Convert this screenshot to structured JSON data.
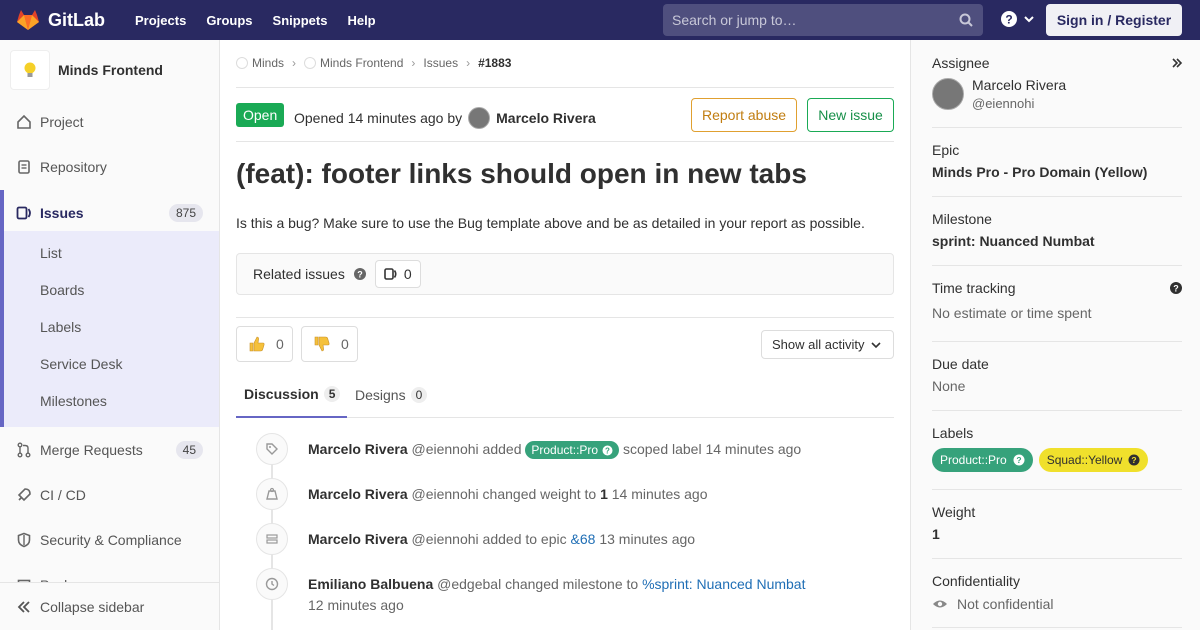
{
  "header": {
    "brand": "GitLab",
    "nav": [
      "Projects",
      "Groups",
      "Snippets",
      "Help"
    ],
    "search_placeholder": "Search or jump to…",
    "sign_in": "Sign in / Register"
  },
  "sidebar": {
    "project_name": "Minds Frontend",
    "items": [
      {
        "label": "Project",
        "icon": "home-icon"
      },
      {
        "label": "Repository",
        "icon": "doc-icon"
      },
      {
        "label": "Issues",
        "icon": "issues-icon",
        "count": "875"
      },
      {
        "label": "Merge Requests",
        "icon": "merge-request-icon",
        "count": "45"
      },
      {
        "label": "CI / CD",
        "icon": "rocket-icon"
      },
      {
        "label": "Security & Compliance",
        "icon": "shield-icon"
      },
      {
        "label": "Packages",
        "icon": "package-icon"
      }
    ],
    "issues_subitems": [
      "List",
      "Boards",
      "Labels",
      "Service Desk",
      "Milestones"
    ],
    "collapse_label": "Collapse sidebar"
  },
  "breadcrumb": [
    "Minds",
    "Minds Frontend",
    "Issues",
    "#1883"
  ],
  "issue": {
    "status": "Open",
    "opened_text": "Opened 14 minutes ago by",
    "author": "Marcelo Rivera",
    "report_abuse": "Report abuse",
    "new_issue": "New issue",
    "title": "(feat): footer links should open in new tabs",
    "description": "Is this a bug? Make sure to use the Bug template above and be as detailed in your report as possible.",
    "related_label": "Related issues",
    "related_count": "0",
    "thumbs_up_count": "0",
    "thumbs_down_count": "0",
    "activity_filter": "Show all activity"
  },
  "tabs": [
    {
      "label": "Discussion",
      "count": "5"
    },
    {
      "label": "Designs",
      "count": "0"
    }
  ],
  "notes": [
    {
      "author": "Marcelo Rivera",
      "handle": "@eiennohi",
      "before": "added",
      "label": "Product::Pro",
      "after": "scoped label 14 minutes ago"
    },
    {
      "author": "Marcelo Rivera",
      "handle": "@eiennohi",
      "before": "changed weight to",
      "strong": "1",
      "after": "14 minutes ago"
    },
    {
      "author": "Marcelo Rivera",
      "handle": "@eiennohi",
      "before": "added to epic",
      "link": "&68",
      "after": "13 minutes ago"
    },
    {
      "author": "Emiliano Balbuena",
      "handle": "@edgebal",
      "before": "changed milestone to",
      "link": "%sprint: Nuanced Numbat",
      "after": "12 minutes ago"
    }
  ],
  "right_sidebar": {
    "assignee_label": "Assignee",
    "assignee_name": "Marcelo Rivera",
    "assignee_handle": "@eiennohi",
    "epic_label": "Epic",
    "epic_value": "Minds Pro - Pro Domain (Yellow)",
    "milestone_label": "Milestone",
    "milestone_value": "sprint: Nuanced Numbat",
    "time_label": "Time tracking",
    "time_value": "No estimate or time spent",
    "due_label": "Due date",
    "due_value": "None",
    "labels_label": "Labels",
    "labels": [
      {
        "text": "Product::Pro",
        "color": "#36a27b"
      },
      {
        "text": "Squad::Yellow",
        "color": "#f0e02c"
      }
    ],
    "weight_label": "Weight",
    "weight_value": "1",
    "conf_label": "Confidentiality",
    "conf_value": "Not confidential"
  },
  "colors": {
    "navbar": "#292961",
    "open": "#1aaa55",
    "accent": "#6666c4"
  }
}
